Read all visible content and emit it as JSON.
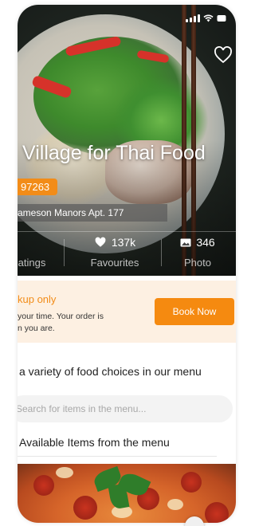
{
  "restaurant": {
    "title": "Village for Thai Food",
    "badge": "97263",
    "address": "ameson Manors Apt. 177"
  },
  "stats": [
    {
      "value": "",
      "label": "atings"
    },
    {
      "value": "137k",
      "label": "Favourites",
      "icon": "heart-icon"
    },
    {
      "value": "346",
      "label": "Photo",
      "icon": "photo-icon"
    }
  ],
  "pickup": {
    "title": "kup only",
    "description_line1": "your time. Your order is",
    "description_line2": "n you are.",
    "button_label": "Book Now"
  },
  "menu": {
    "heading": "a variety of food choices in our menu",
    "search_placeholder": "Search for items in the menu...",
    "available_heading": "Available Items from the menu"
  },
  "colors": {
    "accent": "#f28c18",
    "banner_bg": "#fdf0e2",
    "text": "#222222"
  }
}
